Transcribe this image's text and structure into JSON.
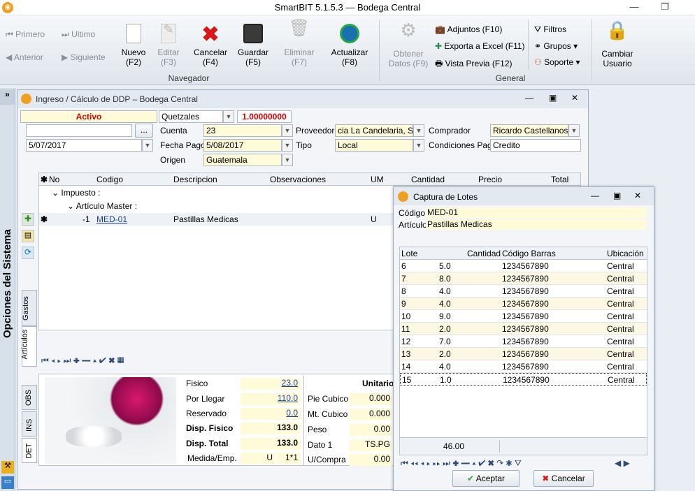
{
  "window": {
    "title": "SmartBIT 5.1.5.3 — Bodega Central"
  },
  "ribbon": {
    "primero": "Primero",
    "ultimo": "Ultimo",
    "anterior": "Anterior",
    "siguiente": "Siguiente",
    "nuevo": "Nuevo",
    "nuevo_key": "(F2)",
    "editar": "Editar",
    "editar_key": "(F3)",
    "cancelar": "Cancelar",
    "cancelar_key": "(F4)",
    "guardar": "Guardar",
    "guardar_key": "(F5)",
    "eliminar": "Eliminar",
    "eliminar_key": "(F7)",
    "actualizar": "Actualizar",
    "actualizar_key": "(F8)",
    "navegador_group": "Navegador",
    "obtener": "Obtener",
    "obtener2": "Datos (F9)",
    "adjuntos": "Adjuntos (F10)",
    "exporta": "Exporta a Excel (F11)",
    "vista": "Vista Previa (F12)",
    "filtros": "Filtros",
    "grupos": "Grupos",
    "soporte": "Soporte",
    "cambiar": "Cambiar",
    "usuario": "Usuario",
    "general_group": "General"
  },
  "sidebar": {
    "label": "Opciones del Sistema"
  },
  "ingreso": {
    "title": "Ingreso / Cálculo de DDP – Bodega Central",
    "estado": "Activo",
    "moneda": "Quetzales",
    "tasa": "1.00000000",
    "fecha": "5/07/2017",
    "cuenta_label": "Cuenta",
    "cuenta": "23",
    "fecha_pago_label": "Fecha Pago",
    "fecha_pago": "5/08/2017",
    "origen_label": "Origen",
    "origen": "Guatemala",
    "proveedor_label": "Proveedor",
    "proveedor": "cia La Candelaria, S.A.",
    "tipo_label": "Tipo",
    "tipo": "Local",
    "comprador_label": "Comprador",
    "comprador": "Ricardo  Castellanos",
    "condiciones_label": "Condiciones Pago",
    "condiciones": "Credito",
    "ellipsis": "..."
  },
  "grid": {
    "headers": [
      "No",
      "Codigo",
      "Descripcion",
      "Observaciones",
      "UM",
      "Cantidad",
      "Precio",
      "Total"
    ],
    "group1": "Impuesto :",
    "group2": "Artículo Master :",
    "row": {
      "no": "-1",
      "codigo": "MED-01",
      "descripcion": "Pastillas Medicas",
      "um": "U"
    }
  },
  "tabs": {
    "gastos": "Gastos",
    "articulos": "Artículos",
    "obs": "OBS",
    "ins": "INS",
    "det": "DET"
  },
  "detalle": {
    "fisico_label": "Fisico",
    "fisico": "23.0",
    "por_llegar_label": "Por Llegar",
    "por_llegar": "110.0",
    "reservado_label": "Reservado",
    "reservado": "0.0",
    "disp_fisico_label": "Disp. Fisico",
    "disp_fisico": "133.0",
    "disp_total_label": "Disp. Total",
    "disp_total": "133.0",
    "medida_label": "Medida/Emp.",
    "medida_u": "U",
    "medida_v": "1*1",
    "unitario_label": "Unitario",
    "pie_label": "Pie Cubico",
    "pie": "0.000",
    "mt_label": "Mt. Cubico",
    "mt": "0.000",
    "peso_label": "Peso",
    "peso": "0.00",
    "dato1_label": "Dato 1",
    "dato1": "TS.PG",
    "ucompra_label": "U/Compra",
    "ucompra": "0.00"
  },
  "lotes": {
    "title": "Captura de Lotes",
    "codigo_label": "Código",
    "codigo": "MED-01",
    "articulo_label": "Artículo",
    "articulo": "Pastillas Medicas",
    "headers": [
      "Lote",
      "Cantidad",
      "Código Barras",
      "Ubicación"
    ],
    "rows": [
      {
        "lote": "6",
        "cantidad": "5.0",
        "barras": "1234567890",
        "ubicacion": "Central"
      },
      {
        "lote": "7",
        "cantidad": "8.0",
        "barras": "1234567890",
        "ubicacion": "Central"
      },
      {
        "lote": "8",
        "cantidad": "4.0",
        "barras": "1234567890",
        "ubicacion": "Central"
      },
      {
        "lote": "9",
        "cantidad": "4.0",
        "barras": "1234567890",
        "ubicacion": "Central"
      },
      {
        "lote": "10",
        "cantidad": "9.0",
        "barras": "1234567890",
        "ubicacion": "Central"
      },
      {
        "lote": "11",
        "cantidad": "2.0",
        "barras": "1234567890",
        "ubicacion": "Central"
      },
      {
        "lote": "12",
        "cantidad": "7.0",
        "barras": "1234567890",
        "ubicacion": "Central"
      },
      {
        "lote": "13",
        "cantidad": "2.0",
        "barras": "1234567890",
        "ubicacion": "Central"
      },
      {
        "lote": "14",
        "cantidad": "4.0",
        "barras": "1234567890",
        "ubicacion": "Central"
      },
      {
        "lote": "15",
        "cantidad": "1.0",
        "barras": "1234567890",
        "ubicacion": "Central"
      }
    ],
    "total": "46.00",
    "aceptar": "Aceptar",
    "cancelar": "Cancelar"
  }
}
